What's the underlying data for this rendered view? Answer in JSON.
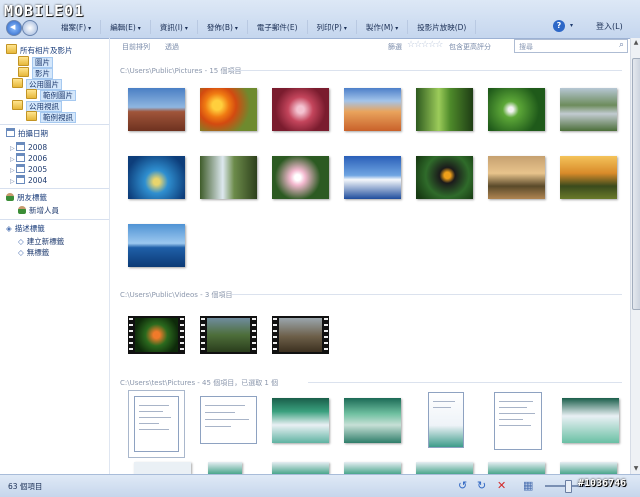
{
  "logo": {
    "text": "MOBILE01"
  },
  "menu": [
    {
      "label": "檔案(F)",
      "arrow": "▾"
    },
    {
      "label": "編輯(E)",
      "arrow": "▾"
    },
    {
      "label": "資訊(I)",
      "arrow": "▾"
    },
    {
      "label": "發佈(B)",
      "arrow": "▾"
    },
    {
      "label": "電子郵件(E)",
      "arrow": ""
    },
    {
      "label": "列印(P)",
      "arrow": "▾"
    },
    {
      "label": "製作(M)",
      "arrow": "▾"
    },
    {
      "label": "投影片放映(D)",
      "arrow": ""
    }
  ],
  "help": {
    "icon": "?",
    "arrow": "▾"
  },
  "login": "登入(L)",
  "sidebar": {
    "all": "所有相片及影片",
    "pictures": "圖片",
    "videos": "影片",
    "public_pictures": "公用圖片",
    "sample_pictures": "範例圖片",
    "public_videos": "公用視訊",
    "sample_videos": "範例視訊",
    "date_taken": "拍攝日期",
    "years": [
      "2008",
      "2006",
      "2005",
      "2004"
    ],
    "people_tags": "朋友標籤",
    "add_person": "新增人員",
    "desc_tags": "描述標籤",
    "create_tag": "建立新標籤",
    "no_tag": "無標籤"
  },
  "subbar": {
    "view_all": "目前排列",
    "filter": "透過",
    "rating_label": "篩選",
    "stars": "☆☆☆☆☆",
    "rating_suffix": "包含更高評分",
    "search_placeholder": "搜尋",
    "search_icon": "⌕"
  },
  "sections": {
    "pictures": "C:\\Users\\Public\\Pictures - 15 個項目",
    "videos": "C:\\Users\\Public\\Videos - 3 個項目",
    "test_pictures": "C:\\Users\\test\\Pictures - 45 個項目，已選取 1 個"
  },
  "status": {
    "count": "63 個項目"
  },
  "bottom_icons": {
    "rotate_left": "↺",
    "rotate_right": "↻",
    "delete": "✕",
    "view": "▦"
  },
  "watermark": "#1036746"
}
